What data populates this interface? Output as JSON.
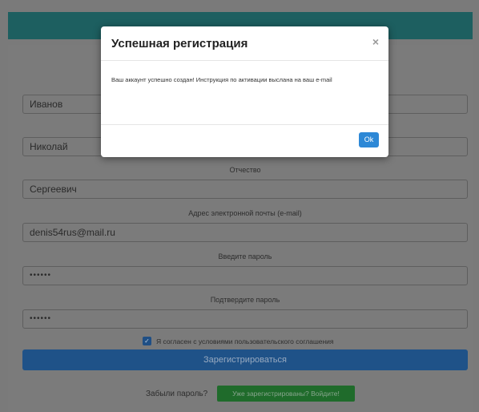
{
  "form": {
    "surname_value": "Иванов",
    "name_value": "Николай",
    "patronymic_label": "Отчество",
    "patronymic_value": "Сергеевич",
    "email_label": "Адрес электронной почты (e-mail)",
    "email_value": "denis54rus@mail.ru",
    "password_label": "Введите пароль",
    "password_value": "••••••",
    "confirm_label": "Подтвердите пароль",
    "confirm_value": "••••••",
    "agree_text": "Я согласен с условиями пользовательского соглашения",
    "agree_checked": true,
    "register_label": "Зарегистрироваться"
  },
  "footer": {
    "forgot_text": "Забыли пароль?",
    "login_label": "Уже зарегистрированы? Войдите!"
  },
  "modal": {
    "title": "Успешная регистрация",
    "close_symbol": "×",
    "message": "Ваш аккаунт успешно создан! Инструкция по активации выслана на ваш e-mail",
    "ok_label": "Ok"
  },
  "colors": {
    "topbar": "#1d5f60",
    "register_button": "#1f5288",
    "login_button": "#1f6b2b",
    "ok_button": "#2d88d6"
  }
}
